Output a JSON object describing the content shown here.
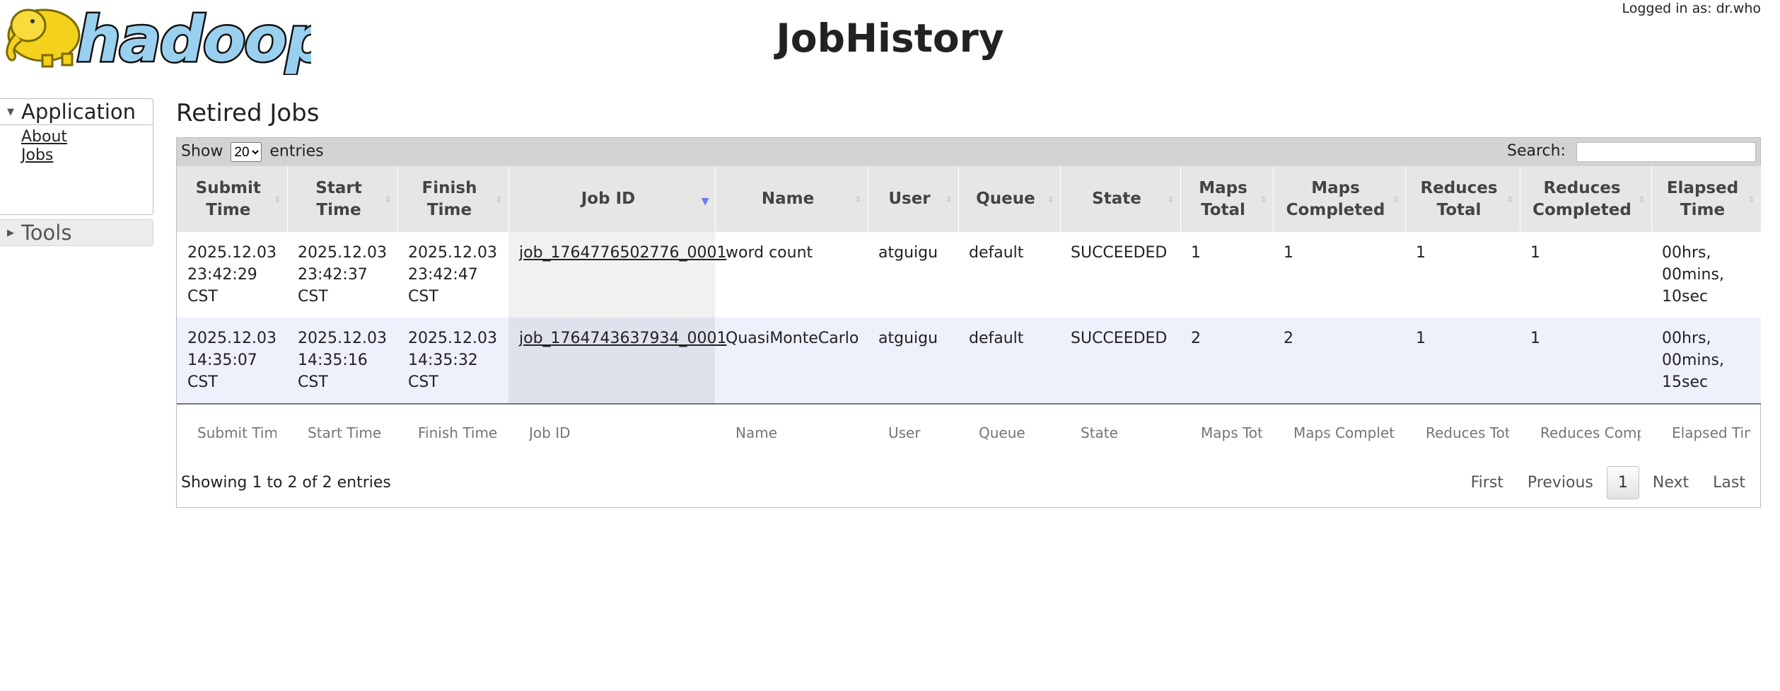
{
  "header": {
    "title": "JobHistory",
    "logged_in": "Logged in as: dr.who",
    "logo_text": "hadoop"
  },
  "sidebar": {
    "sections": [
      {
        "label": "Application",
        "expanded": true,
        "links": [
          {
            "label": "About"
          },
          {
            "label": "Jobs"
          }
        ]
      },
      {
        "label": "Tools",
        "expanded": false
      }
    ]
  },
  "main": {
    "section_title": "Retired Jobs",
    "length_prefix": "Show",
    "length_value": "20",
    "length_suffix": "entries",
    "search_label": "Search:",
    "columns": [
      "Submit Time",
      "Start Time",
      "Finish Time",
      "Job ID",
      "Name",
      "User",
      "Queue",
      "State",
      "Maps Total",
      "Maps Completed",
      "Reduces Total",
      "Reduces Completed",
      "Elapsed Time"
    ],
    "sorted_column": "Job ID",
    "rows": [
      {
        "submit": [
          "2025.12.03",
          "23:42:29",
          "CST"
        ],
        "start": [
          "2025.12.03",
          "23:42:37",
          "CST"
        ],
        "finish": [
          "2025.12.03",
          "23:42:47",
          "CST"
        ],
        "job_id": "job_1764776502776_0001",
        "name": "word count",
        "user": "atguigu",
        "queue": "default",
        "state": "SUCCEEDED",
        "maps_total": "1",
        "maps_completed": "1",
        "reduces_total": "1",
        "reduces_completed": "1",
        "elapsed": [
          "00hrs,",
          "00mins,",
          "10sec"
        ]
      },
      {
        "submit": [
          "2025.12.03",
          "14:35:07",
          "CST"
        ],
        "start": [
          "2025.12.03",
          "14:35:16",
          "CST"
        ],
        "finish": [
          "2025.12.03",
          "14:35:32",
          "CST"
        ],
        "job_id": "job_1764743637934_0001",
        "name": "QuasiMonteCarlo",
        "user": "atguigu",
        "queue": "default",
        "state": "SUCCEEDED",
        "maps_total": "2",
        "maps_completed": "2",
        "reduces_total": "1",
        "reduces_completed": "1",
        "elapsed": [
          "00hrs,",
          "00mins,",
          "15sec"
        ]
      }
    ],
    "filter_placeholders": [
      "Submit Time",
      "Start Time",
      "Finish Time",
      "Job ID",
      "Name",
      "User",
      "Queue",
      "State",
      "Maps Total",
      "Maps Completed",
      "Reduces Total",
      "Reduces Completed",
      "Elapsed Time"
    ],
    "info": "Showing 1 to 2 of 2 entries",
    "pager": {
      "first": "First",
      "previous": "Previous",
      "current": "1",
      "next": "Next",
      "last": "Last"
    }
  }
}
